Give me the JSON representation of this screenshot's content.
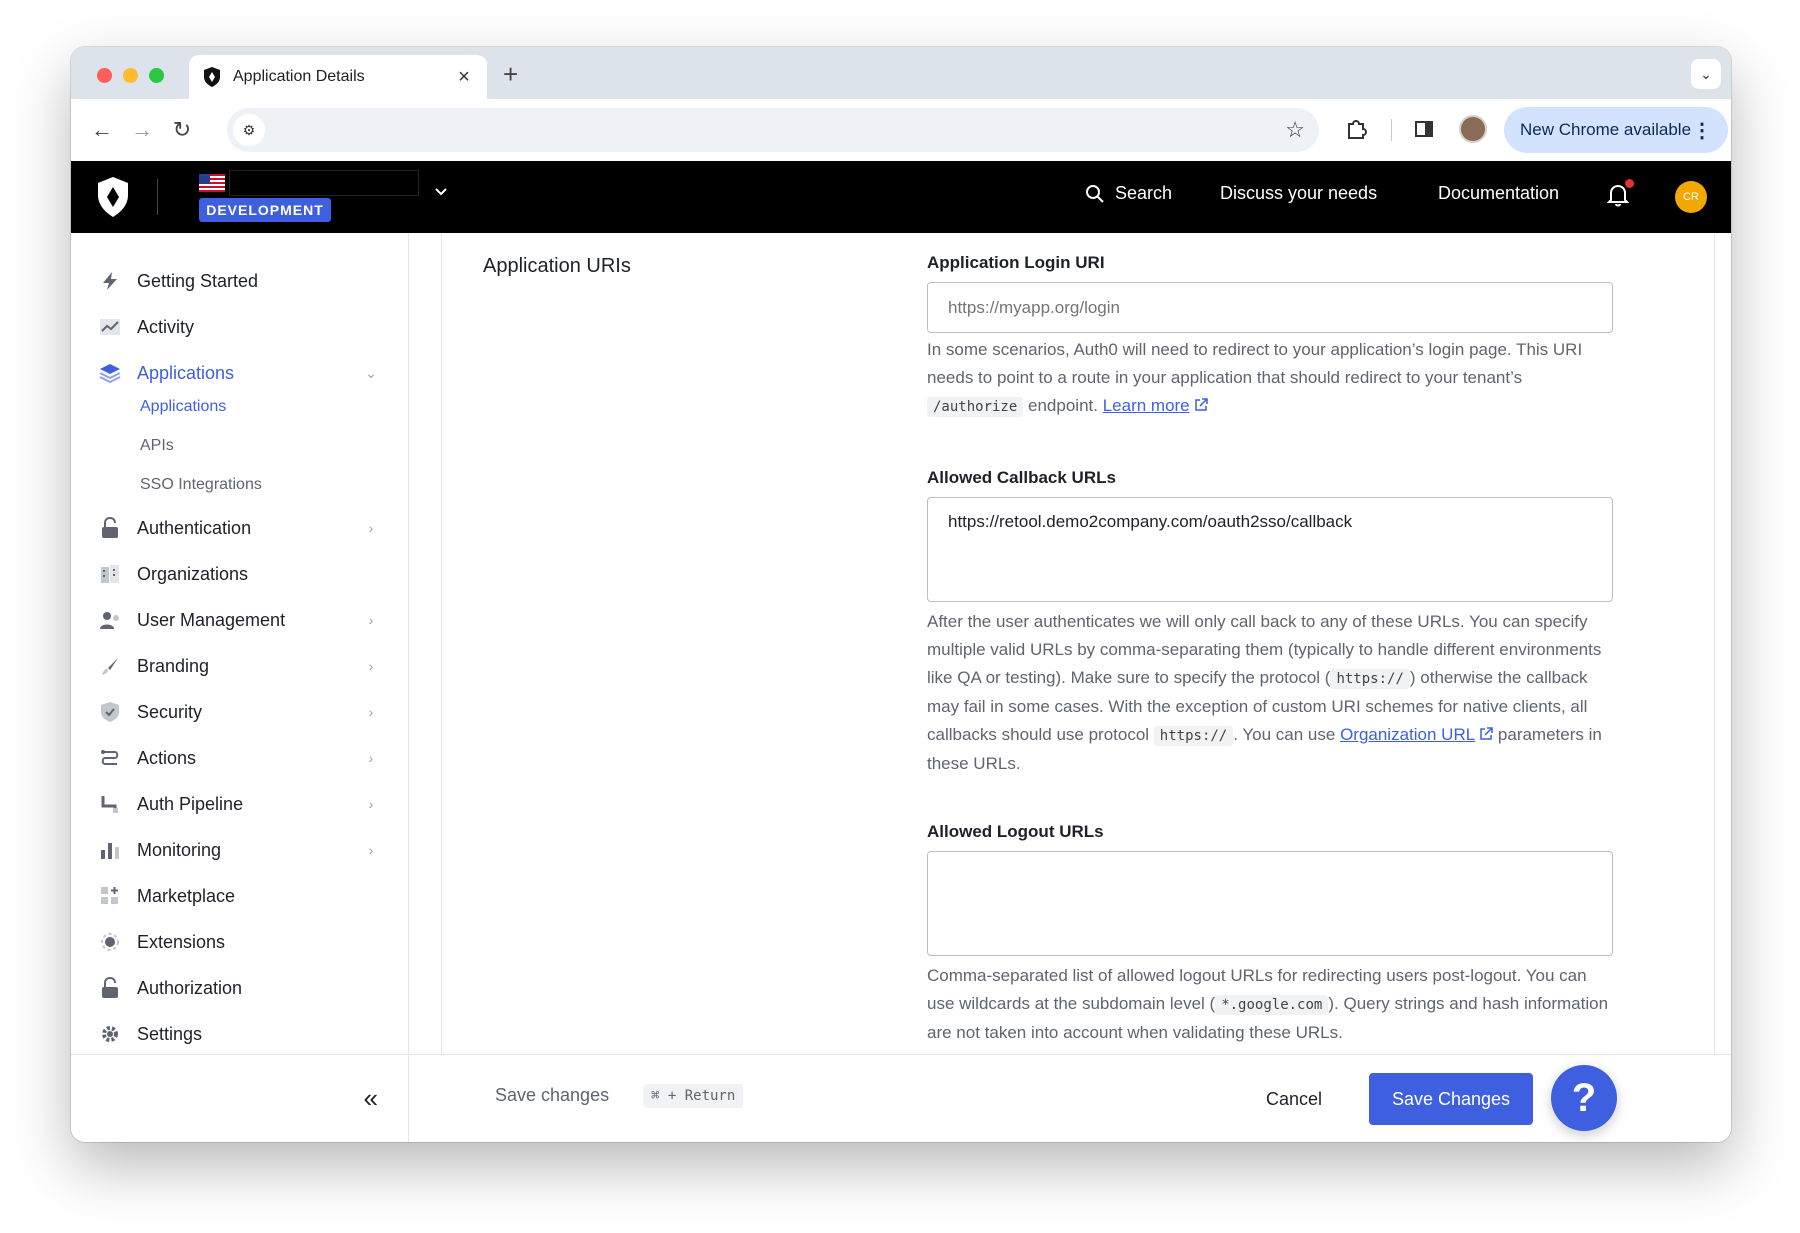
{
  "browser": {
    "tab_title": "Application Details",
    "new_tab_symbol": "+",
    "chrome_update_label": "New Chrome available"
  },
  "header": {
    "environment_badge": "DEVELOPMENT",
    "nav": {
      "search": "Search",
      "discuss": "Discuss your needs",
      "documentation": "Documentation"
    },
    "avatar_initials": "CR"
  },
  "sidebar": {
    "items": [
      {
        "label": "Getting Started",
        "icon": "bolt-icon"
      },
      {
        "label": "Activity",
        "icon": "activity-chart-icon"
      },
      {
        "label": "Applications",
        "icon": "layers-icon"
      },
      {
        "label": "Authentication",
        "icon": "lock-icon"
      },
      {
        "label": "Organizations",
        "icon": "building-icon"
      },
      {
        "label": "User Management",
        "icon": "users-icon"
      },
      {
        "label": "Branding",
        "icon": "brush-icon"
      },
      {
        "label": "Security",
        "icon": "shield-icon"
      },
      {
        "label": "Actions",
        "icon": "actions-icon"
      },
      {
        "label": "Auth Pipeline",
        "icon": "pipeline-icon"
      },
      {
        "label": "Monitoring",
        "icon": "bar-chart-icon"
      },
      {
        "label": "Marketplace",
        "icon": "marketplace-icon"
      },
      {
        "label": "Extensions",
        "icon": "extensions-icon"
      },
      {
        "label": "Authorization",
        "icon": "lock-icon"
      },
      {
        "label": "Settings",
        "icon": "gear-icon"
      }
    ],
    "subitems": [
      {
        "label": "Applications"
      },
      {
        "label": "APIs"
      },
      {
        "label": "SSO Integrations"
      }
    ]
  },
  "content": {
    "section_title": "Application URIs",
    "login_uri": {
      "label": "Application Login URI",
      "placeholder": "https://myapp.org/login",
      "help_1": "In some scenarios, Auth0 will need to redirect to your application’s login page. This URI needs to point to a route in your application that should redirect to your tenant’s ",
      "help_code": "/authorize",
      "help_2": " endpoint. ",
      "help_link": "Learn more"
    },
    "callback": {
      "label": "Allowed Callback URLs",
      "value": "https://retool.demo2company.com/oauth2sso/callback",
      "help_1": "After the user authenticates we will only call back to any of these URLs. You can specify multiple valid URLs by comma-separating them (typically to handle different environments like QA or testing). Make sure to specify the protocol (",
      "help_code_1": "https://",
      "help_2": ") otherwise the callback may fail in some cases. With the exception of custom URI schemes for native clients, all callbacks should use protocol ",
      "help_code_2": "https://",
      "help_3": ". You can use ",
      "help_link": "Organization URL",
      "help_4": " parameters in these URLs."
    },
    "logout": {
      "label": "Allowed Logout URLs",
      "value": "",
      "help_1": "Comma-separated list of allowed logout URLs for redirecting users post-logout. You can use wildcards at the subdomain level (",
      "help_code": "*.google.com",
      "help_2": "). Query strings and hash information are not taken into account when validating these URLs."
    }
  },
  "savebar": {
    "hint": "Save changes",
    "shortcut": "⌘ + Return",
    "cancel": "Cancel",
    "save": "Save Changes",
    "help_fab": "?"
  },
  "colors": {
    "accent": "#3e5fe0",
    "header_bg": "#000000",
    "avatar": "#f2a800"
  }
}
